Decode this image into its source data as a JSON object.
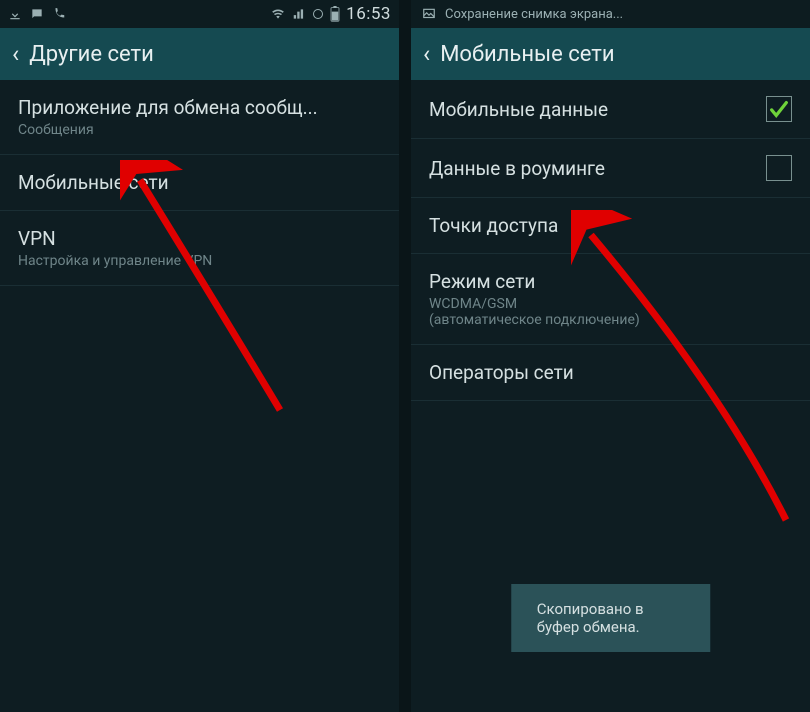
{
  "left": {
    "status": {
      "time": "16:53"
    },
    "header": {
      "title": "Другие сети"
    },
    "items": [
      {
        "title": "Приложение для обмена сообщ...",
        "sub": "Сообщения"
      },
      {
        "title": "Мобильные сети",
        "sub": ""
      },
      {
        "title": "VPN",
        "sub": "Настройка и управление VPN"
      }
    ]
  },
  "right": {
    "notif": {
      "text": "Сохранение снимка экрана..."
    },
    "header": {
      "title": "Мобильные сети"
    },
    "items": [
      {
        "title": "Мобильные данные",
        "sub": "",
        "checkbox": true,
        "checked": true
      },
      {
        "title": "Данные в роуминге",
        "sub": "",
        "checkbox": true,
        "checked": false
      },
      {
        "title": "Точки доступа",
        "sub": ""
      },
      {
        "title": "Режим сети",
        "sub": "WCDMA/GSM\n(автоматическое подключение)"
      },
      {
        "title": "Операторы сети",
        "sub": ""
      }
    ],
    "toast": "Скопировано в буфер обмена."
  }
}
